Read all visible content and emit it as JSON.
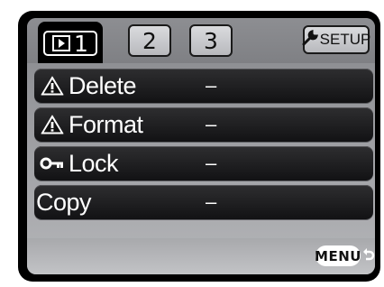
{
  "tabs": [
    {
      "label": "1",
      "icon": "playback-icon",
      "active": true
    },
    {
      "label": "2",
      "active": false
    },
    {
      "label": "3",
      "active": false
    }
  ],
  "setup_tab": {
    "label": "SETUP",
    "icon": "wrench-icon"
  },
  "menu_items": [
    {
      "label": "Delete",
      "value": "–",
      "icon": "warning-icon"
    },
    {
      "label": "Format",
      "value": "–",
      "icon": "warning-icon"
    },
    {
      "label": "Lock",
      "value": "–",
      "icon": "key-icon"
    },
    {
      "label": "Copy",
      "value": "–",
      "icon": ""
    }
  ],
  "footer": {
    "menu_label": "MENU",
    "return_icon": "return-arrow-icon"
  },
  "colors": {
    "panel": "#9c9da1",
    "row": "#1f1f21",
    "text": "#ffffff",
    "active_tab": "#000000"
  }
}
